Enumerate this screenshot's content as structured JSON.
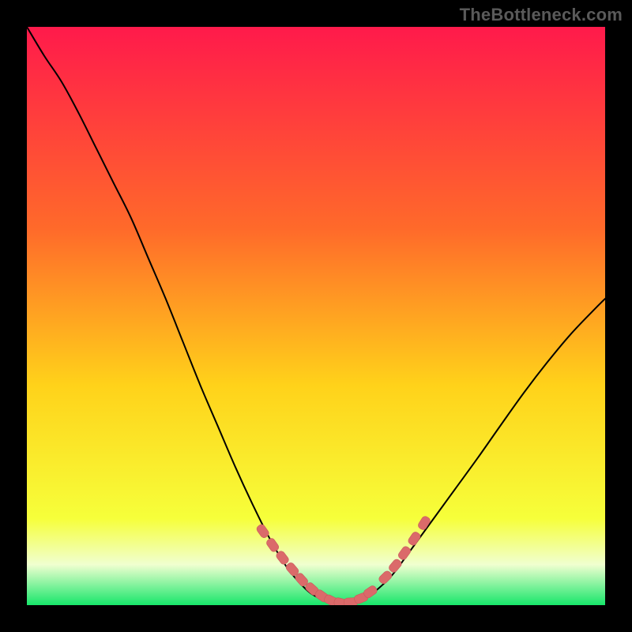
{
  "watermark": "TheBottleneck.com",
  "colors": {
    "gradient_top": "#ff1a4b",
    "gradient_mid1": "#ff6a2a",
    "gradient_mid2": "#ffd21a",
    "gradient_mid3": "#f6ff3a",
    "gradient_bottom_band": "#f0ffd0",
    "gradient_bottom": "#17e66a",
    "curve": "#000000",
    "marker_fill": "#db6a6a",
    "marker_stroke": "#c95a5a"
  },
  "chart_data": {
    "type": "line",
    "title": "",
    "xlabel": "",
    "ylabel": "",
    "xlim": [
      0,
      100
    ],
    "ylim": [
      0,
      100
    ],
    "series": [
      {
        "name": "bottleneck-curve",
        "x": [
          0,
          3,
          6,
          9,
          12,
          15,
          18,
          21,
          24,
          27,
          30,
          33,
          36,
          39,
          42,
          45,
          48,
          50,
          52,
          54,
          56,
          58,
          60,
          63,
          66,
          70,
          74,
          78,
          82,
          86,
          90,
          94,
          98,
          100
        ],
        "y": [
          100,
          95,
          90.5,
          85,
          79,
          73,
          67,
          60,
          53,
          45.5,
          38,
          31,
          24,
          17.5,
          11.5,
          6.5,
          3,
          1.5,
          0.7,
          0.3,
          0.3,
          0.9,
          2.2,
          5,
          9,
          14.5,
          20,
          25.5,
          31.2,
          36.8,
          42,
          46.8,
          51,
          53
        ]
      }
    ],
    "markers": {
      "name": "highlight-dots",
      "x": [
        40.8,
        42.5,
        44.2,
        45.9,
        47.5,
        49.3,
        51.0,
        52.6,
        54.3,
        56.0,
        57.8,
        59.4,
        62.0,
        63.7,
        65.3,
        67.0,
        68.7
      ],
      "y": [
        12.8,
        10.4,
        8.2,
        6.2,
        4.4,
        2.8,
        1.6,
        0.8,
        0.4,
        0.5,
        1.2,
        2.3,
        4.8,
        6.8,
        9.0,
        11.5,
        14.2
      ]
    },
    "gradient_stops": [
      {
        "offset": 0.0,
        "key": "gradient_top"
      },
      {
        "offset": 0.35,
        "key": "gradient_mid1"
      },
      {
        "offset": 0.62,
        "key": "gradient_mid2"
      },
      {
        "offset": 0.85,
        "key": "gradient_mid3"
      },
      {
        "offset": 0.93,
        "key": "gradient_bottom_band"
      },
      {
        "offset": 1.0,
        "key": "gradient_bottom"
      }
    ]
  }
}
